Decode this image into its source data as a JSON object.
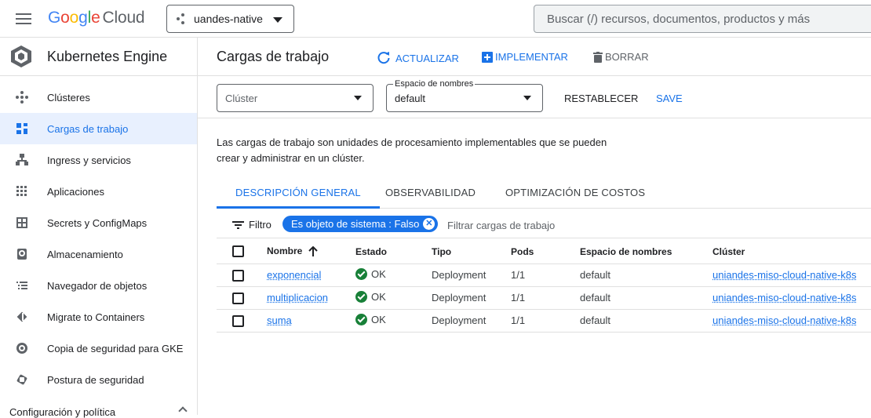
{
  "topbar": {
    "brand_google": [
      "G",
      "o",
      "o",
      "g",
      "l",
      "e"
    ],
    "brand_cloud": "Cloud",
    "project": "uandes-native",
    "search_placeholder": "Buscar (/) recursos, documentos, productos y más"
  },
  "sidebar": {
    "title": "Kubernetes Engine",
    "items": [
      {
        "label": "Clústeres",
        "icon": "clusters-icon"
      },
      {
        "label": "Cargas de trabajo",
        "icon": "workloads-icon",
        "active": true
      },
      {
        "label": "Ingress y servicios",
        "icon": "ingress-icon"
      },
      {
        "label": "Aplicaciones",
        "icon": "apps-grid-icon"
      },
      {
        "label": "Secrets y ConfigMaps",
        "icon": "secrets-icon"
      },
      {
        "label": "Almacenamiento",
        "icon": "storage-icon"
      },
      {
        "label": "Navegador de objetos",
        "icon": "object-browser-icon"
      },
      {
        "label": "Migrate to Containers",
        "icon": "migrate-icon"
      },
      {
        "label": "Copia de seguridad para GKE",
        "icon": "backup-icon"
      },
      {
        "label": "Postura de seguridad",
        "icon": "security-icon"
      }
    ],
    "section": "Configuración y política"
  },
  "header": {
    "title": "Cargas de trabajo",
    "refresh": "ACTUALIZAR",
    "deploy": "IMPLEMENTAR",
    "delete": "BORRAR"
  },
  "filters": {
    "cluster_placeholder": "Clúster",
    "namespace_label": "Espacio de nombres",
    "namespace_value": "default",
    "reset": "RESTABLECER",
    "save": "SAVE"
  },
  "description": "Las cargas de trabajo son unidades de procesamiento implementables que se pueden crear y administrar en un clúster.",
  "tabs": [
    "DESCRIPCIÓN GENERAL",
    "OBSERVABILIDAD",
    "OPTIMIZACIÓN DE COSTOS"
  ],
  "filterbar": {
    "label": "Filtro",
    "chip": "Es objeto de sistema : Falso",
    "placeholder": "Filtrar cargas de trabajo"
  },
  "table": {
    "headers": [
      "Nombre",
      "Estado",
      "Tipo",
      "Pods",
      "Espacio de nombres",
      "Clúster"
    ],
    "rows": [
      {
        "name": "exponencial",
        "status": "OK",
        "type": "Deployment",
        "pods": "1/1",
        "namespace": "default",
        "cluster": "uniandes-miso-cloud-native-k8s"
      },
      {
        "name": "multiplicacion",
        "status": "OK",
        "type": "Deployment",
        "pods": "1/1",
        "namespace": "default",
        "cluster": "uniandes-miso-cloud-native-k8s"
      },
      {
        "name": "suma",
        "status": "OK",
        "type": "Deployment",
        "pods": "1/1",
        "namespace": "default",
        "cluster": "uniandes-miso-cloud-native-k8s"
      }
    ]
  }
}
